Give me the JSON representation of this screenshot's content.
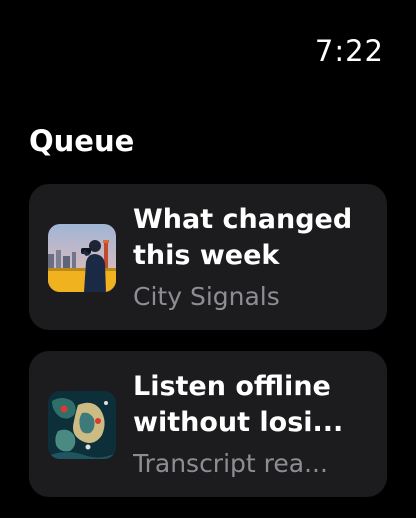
{
  "status": {
    "time": "7:22"
  },
  "section": {
    "title": "Queue"
  },
  "queue": [
    {
      "title": "What changed this week",
      "subtitle": "City Signals",
      "artwork": "city-skyline-person-artwork"
    },
    {
      "title": "Listen offline without losi...",
      "subtitle": "Transcript rea...",
      "artwork": "abstract-map-artwork"
    }
  ]
}
